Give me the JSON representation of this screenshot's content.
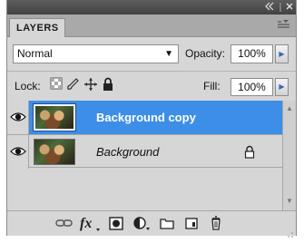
{
  "titlebar": {
    "collapse_glyph": "44",
    "close_glyph": "x"
  },
  "tab": {
    "label": "LAYERS",
    "menu_icon": "panel-menu-icon"
  },
  "blend_mode": {
    "value": "Normal"
  },
  "opacity": {
    "label": "Opacity:",
    "value": "100%"
  },
  "lock": {
    "label": "Lock:",
    "icons": [
      "lock-transparent-pixels-icon",
      "lock-image-pixels-icon",
      "lock-position-icon",
      "lock-all-icon"
    ]
  },
  "fill": {
    "label": "Fill:",
    "value": "100%"
  },
  "layers": [
    {
      "name": "Background copy",
      "visible": true,
      "selected": true,
      "locked": false
    },
    {
      "name": "Background",
      "visible": true,
      "selected": false,
      "locked": true
    }
  ],
  "bottom_toolbar": {
    "icons": [
      "link-layers-icon",
      "layer-style-icon",
      "add-mask-icon",
      "adjustment-layer-icon",
      "new-group-icon",
      "new-layer-icon",
      "delete-layer-icon"
    ]
  },
  "colors": {
    "selection": "#3d8ee6",
    "panel": "#d6d6d6",
    "titlebar": "#4a4a4a"
  }
}
